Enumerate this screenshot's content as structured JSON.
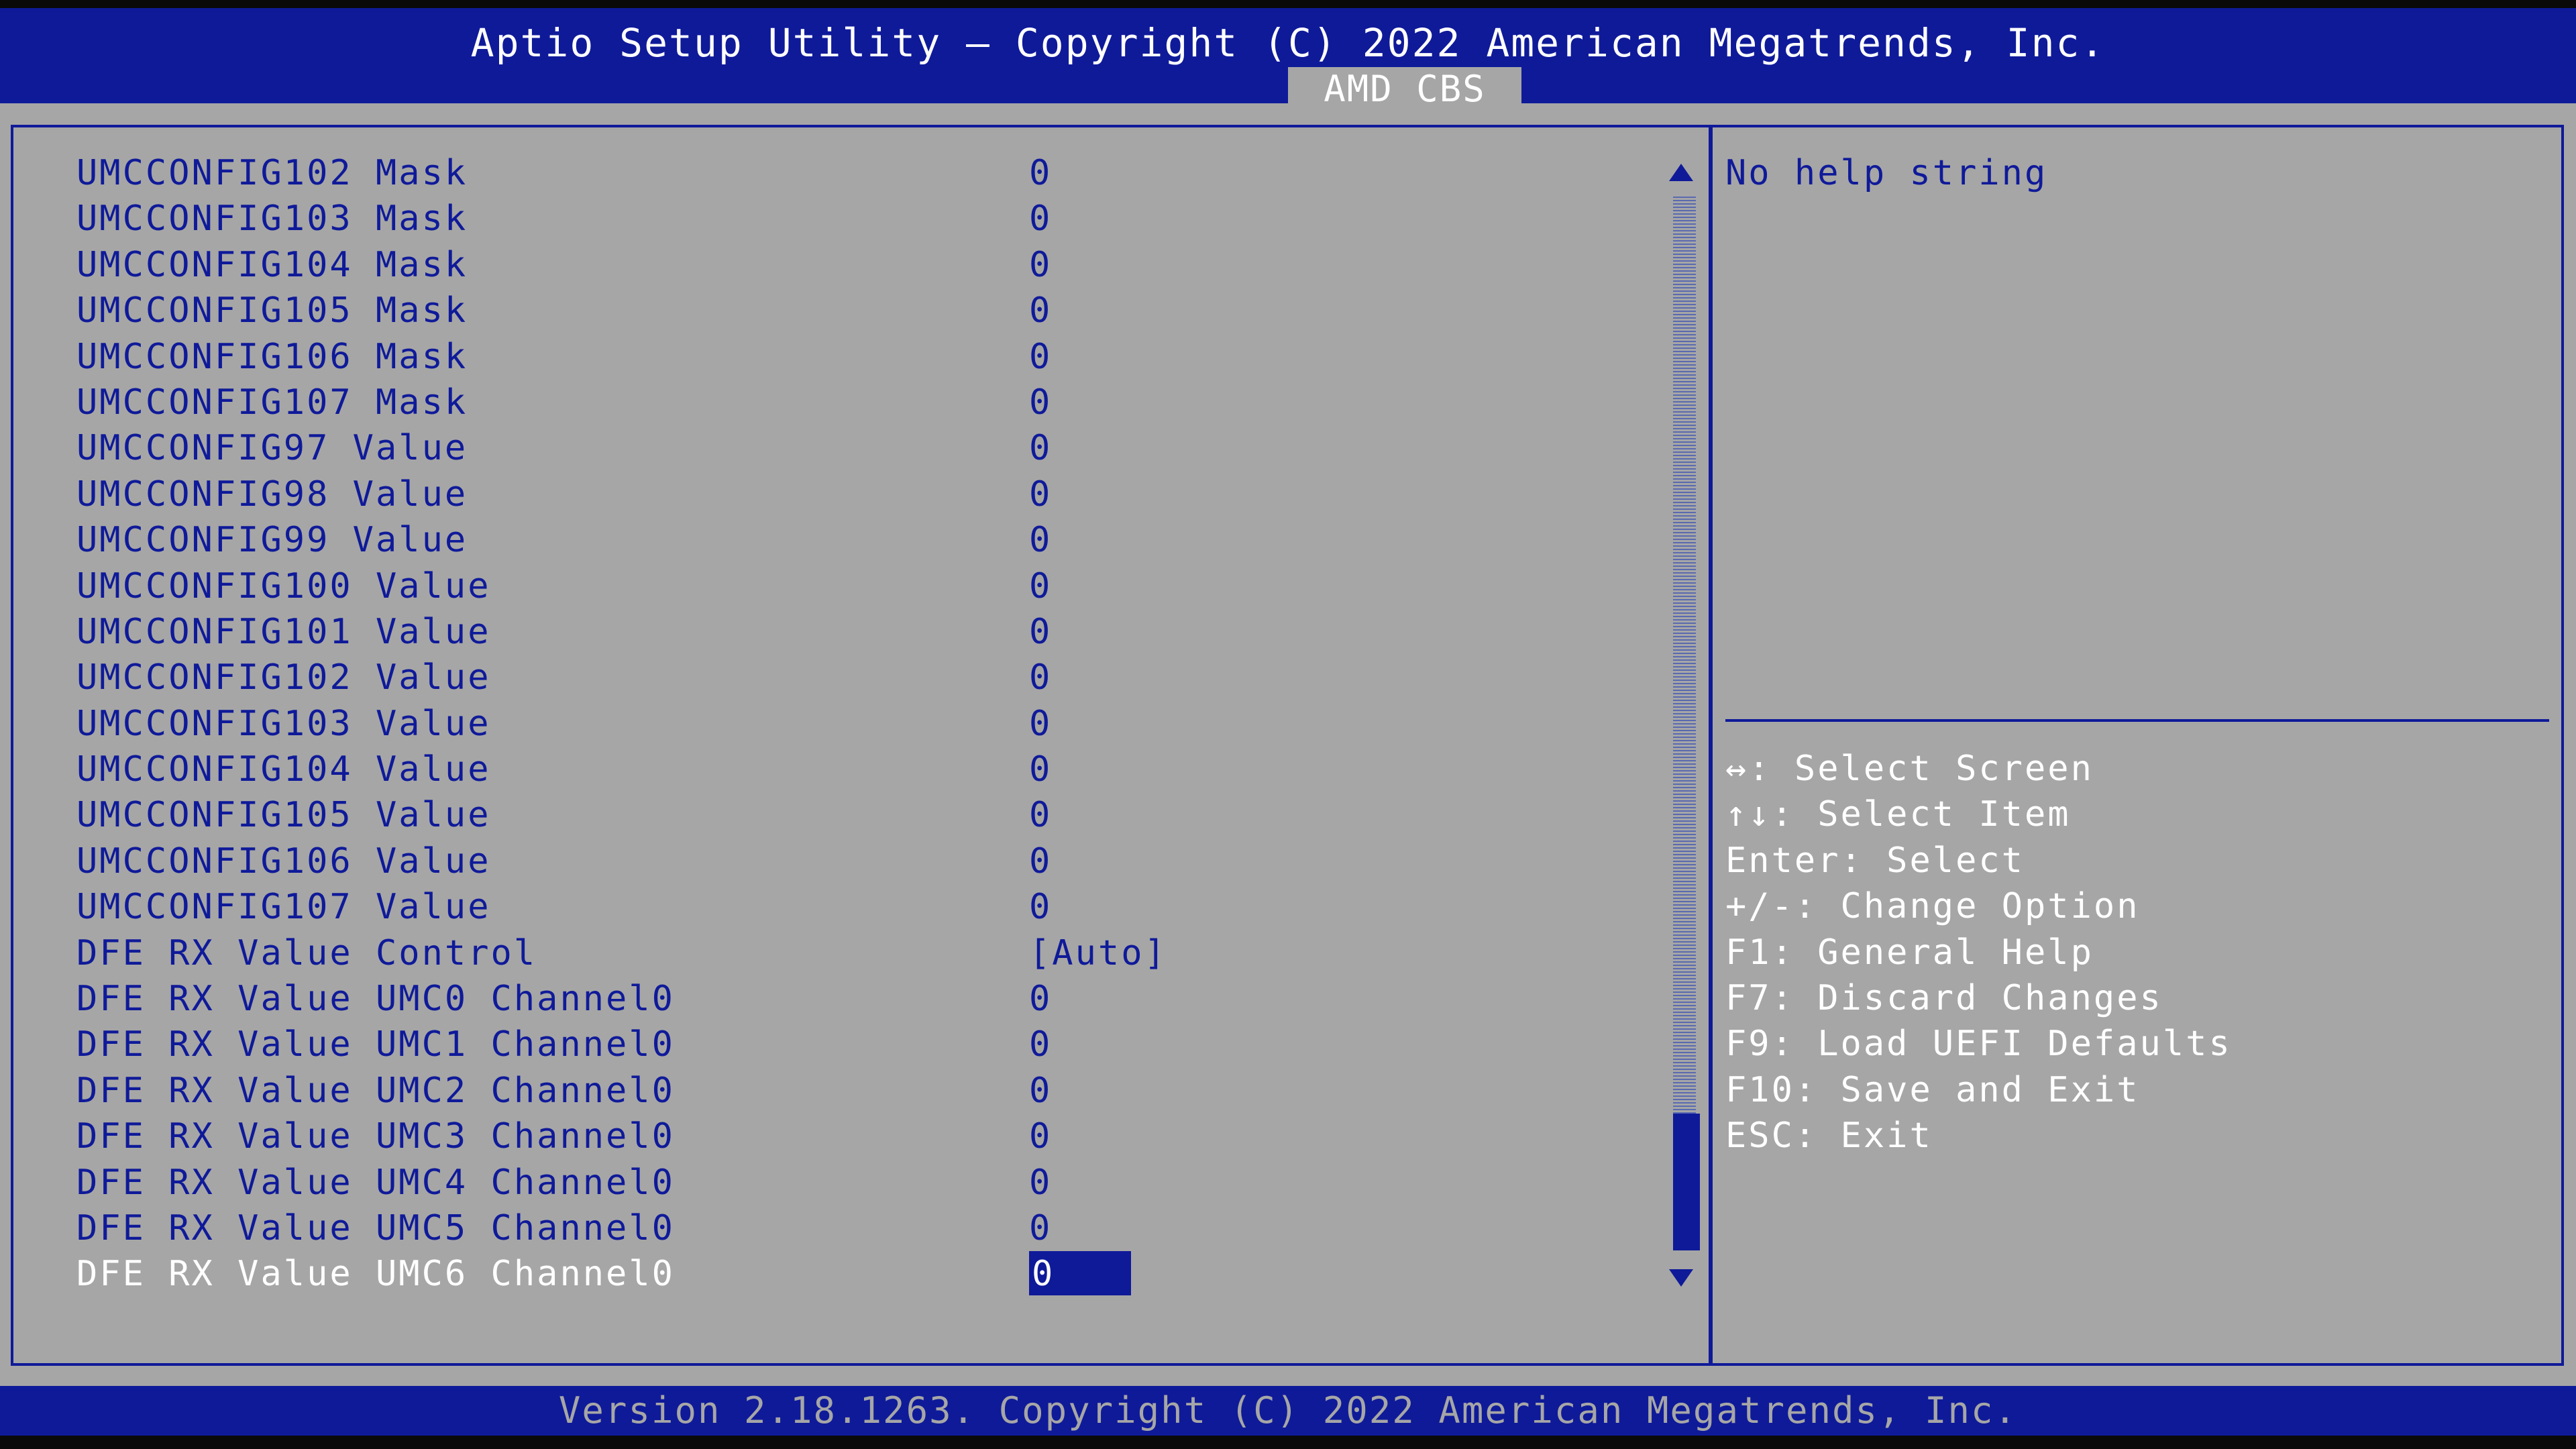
{
  "header": {
    "title": "Aptio Setup Utility – Copyright (C) 2022 American Megatrends, Inc.",
    "tab": "AMD CBS"
  },
  "settings": [
    {
      "label": "UMCCONFIG102 Mask",
      "value": "0"
    },
    {
      "label": "UMCCONFIG103 Mask",
      "value": "0"
    },
    {
      "label": "UMCCONFIG104 Mask",
      "value": "0"
    },
    {
      "label": "UMCCONFIG105 Mask",
      "value": "0"
    },
    {
      "label": "UMCCONFIG106 Mask",
      "value": "0"
    },
    {
      "label": "UMCCONFIG107 Mask",
      "value": "0"
    },
    {
      "label": "UMCCONFIG97 Value",
      "value": "0"
    },
    {
      "label": "UMCCONFIG98 Value",
      "value": "0"
    },
    {
      "label": "UMCCONFIG99 Value",
      "value": "0"
    },
    {
      "label": "UMCCONFIG100 Value",
      "value": "0"
    },
    {
      "label": "UMCCONFIG101 Value",
      "value": "0"
    },
    {
      "label": "UMCCONFIG102 Value",
      "value": "0"
    },
    {
      "label": "UMCCONFIG103 Value",
      "value": "0"
    },
    {
      "label": "UMCCONFIG104 Value",
      "value": "0"
    },
    {
      "label": "UMCCONFIG105 Value",
      "value": "0"
    },
    {
      "label": "UMCCONFIG106 Value",
      "value": "0"
    },
    {
      "label": "UMCCONFIG107 Value",
      "value": "0"
    },
    {
      "label": "DFE RX Value Control",
      "value": "[Auto]"
    },
    {
      "label": "DFE RX Value UMC0 Channel0",
      "value": "0"
    },
    {
      "label": "DFE RX Value UMC1 Channel0",
      "value": "0"
    },
    {
      "label": "DFE RX Value UMC2 Channel0",
      "value": "0"
    },
    {
      "label": "DFE RX Value UMC3 Channel0",
      "value": "0"
    },
    {
      "label": "DFE RX Value UMC4 Channel0",
      "value": "0"
    },
    {
      "label": "DFE RX Value UMC5 Channel0",
      "value": "0"
    },
    {
      "label": "DFE RX Value UMC6 Channel0",
      "value": "0",
      "selected": true
    }
  ],
  "help": {
    "text": "No help string"
  },
  "keys": [
    "↔: Select Screen",
    "↑↓: Select Item",
    "Enter: Select",
    "+/-: Change Option",
    "F1: General Help",
    "F7: Discard Changes",
    "F9: Load UEFI Defaults",
    "F10: Save and Exit",
    "ESC: Exit"
  ],
  "footer": {
    "version": "Version 2.18.1263. Copyright (C) 2022 American Megatrends, Inc."
  },
  "colors": {
    "bios_blue": "#0f1a99",
    "panel_gray": "#a6a6a6",
    "text_white": "#ffffff"
  }
}
